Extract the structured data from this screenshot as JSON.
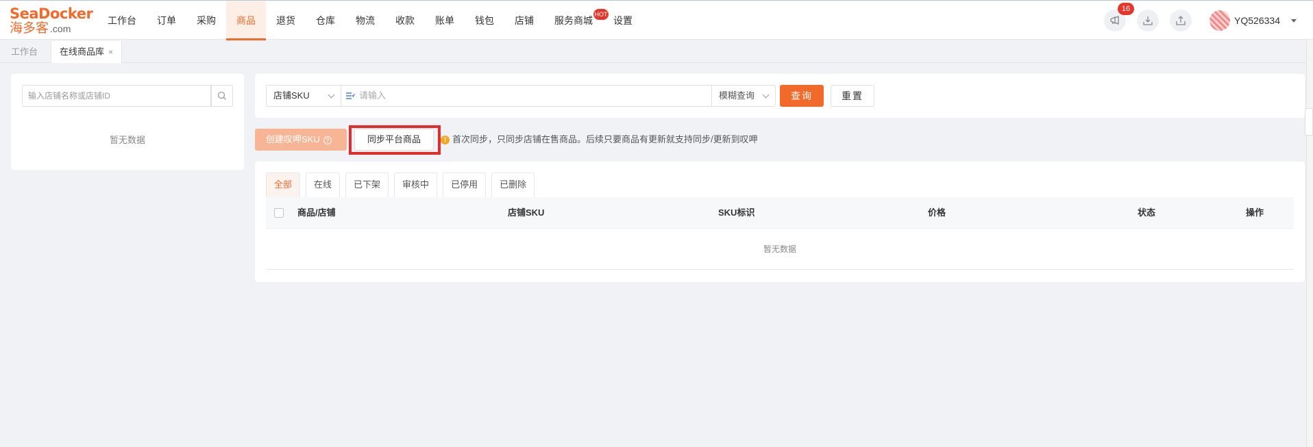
{
  "brand": {
    "logo_line1": "SeaDocker",
    "logo_line2": "海多客",
    "logo_suffix": ".com",
    "color": "#f26a2a"
  },
  "nav": {
    "items": [
      {
        "label": "工作台"
      },
      {
        "label": "订单"
      },
      {
        "label": "采购"
      },
      {
        "label": "商品",
        "active": true
      },
      {
        "label": "退货"
      },
      {
        "label": "仓库"
      },
      {
        "label": "物流"
      },
      {
        "label": "收款"
      },
      {
        "label": "账单"
      },
      {
        "label": "钱包"
      },
      {
        "label": "店铺"
      },
      {
        "label": "服务商城",
        "badge": "HOT"
      },
      {
        "label": "设置"
      }
    ]
  },
  "header_right": {
    "notice_count": "16",
    "username": "YQ526334"
  },
  "page_tabs": [
    {
      "label": "工作台"
    },
    {
      "label": "在线商品库",
      "close": "×"
    }
  ],
  "left_panel": {
    "search_placeholder": "输入店铺名称或店铺ID",
    "empty_text": "暂无数据"
  },
  "search": {
    "field_select": "店铺SKU",
    "input_placeholder": "请输入",
    "mode_select": "模糊查询",
    "query_button": "查询",
    "reset_button": "重置"
  },
  "actions": {
    "create_button": "创建叹呷SKU",
    "help_mark": "?",
    "sync_button": "同步平台商品",
    "tip_icon": "!",
    "tip": "首次同步，只同步店铺在售商品。后续只要商品有更新就支持同步/更新到叹呷"
  },
  "status_tabs": [
    {
      "label": "全部",
      "active": true
    },
    {
      "label": "在线"
    },
    {
      "label": "已下架"
    },
    {
      "label": "审核中"
    },
    {
      "label": "已停用"
    },
    {
      "label": "已删除"
    }
  ],
  "table": {
    "columns": [
      "商品/店铺",
      "店铺SKU",
      "SKU标识",
      "价格",
      "状态",
      "操作"
    ],
    "empty_text": "暂无数据"
  }
}
